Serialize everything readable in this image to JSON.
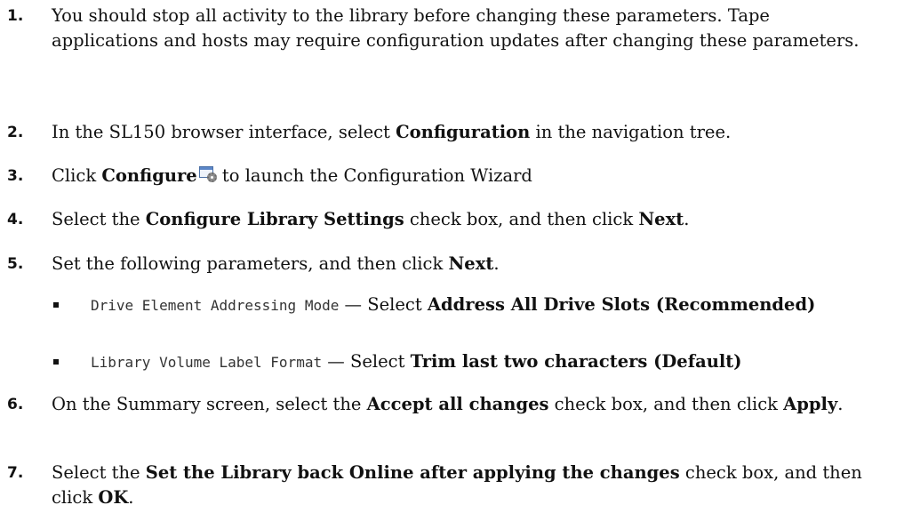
{
  "steps": [
    {
      "number": "1.",
      "text": "You should stop all activity to the library before changing these parameters. Tape applications and hosts may require configuration updates after changing these parameters."
    },
    {
      "number": "2.",
      "t1": "In the SL150 browser interface, select ",
      "b1": "Configuration",
      "t2": " in the navigation tree."
    },
    {
      "number": "3.",
      "t1": "Click ",
      "b1": "Configure",
      "icon": "configure-wizard-icon",
      "t2": " to launch the Configuration Wizard"
    },
    {
      "number": "4.",
      "t1": "Select the ",
      "b1": "Configure Library Settings",
      "t2": " check box, and then click ",
      "b2": "Next",
      "t3": "."
    },
    {
      "number": "5.",
      "t1": "Set the following parameters, and then click ",
      "b1": "Next",
      "t2": ".",
      "params": [
        {
          "name": "Drive Element Addressing Mode",
          "sep": " — Select ",
          "value": "Address All Drive Slots (Recommended)"
        },
        {
          "name": "Library Volume Label Format",
          "sep": " — Select ",
          "value": "Trim last two characters (Default)"
        }
      ]
    },
    {
      "number": "6.",
      "t1": "On the Summary screen, select the ",
      "b1": "Accept all changes",
      "t2": " check box, and then click ",
      "b2": "Apply",
      "t3": "."
    },
    {
      "number": "7.",
      "t1": "Select the ",
      "b1": "Set the Library back Online after applying the changes",
      "t2": " check box, and then click ",
      "b2": "OK",
      "t3": "."
    }
  ]
}
